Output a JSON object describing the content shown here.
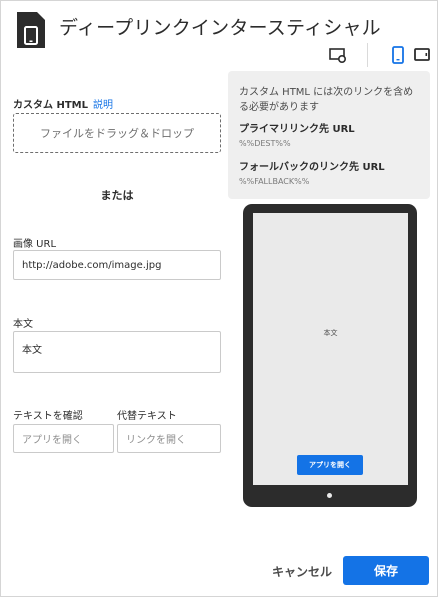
{
  "dialog": {
    "title": "ディープリンクインタースティシャル",
    "icons": [
      "mobile-page-icon",
      "preview-icon",
      "phone-icon",
      "tablet-icon"
    ],
    "accent_color": "#1473e6"
  },
  "form": {
    "custom_html_label": "カスタム HTML",
    "help_link": "説明",
    "dropzone_text": "ファイルをドラッグ＆ドロップ",
    "or_label": "または",
    "image_url": {
      "label": "画像 URL",
      "value": "http://adobe.com/image.jpg"
    },
    "body": {
      "label": "本文",
      "value": "本文"
    },
    "confirm_text": {
      "label": "テキストを確認",
      "placeholder": "アプリを開く"
    },
    "alt_text": {
      "label": "代替テキスト",
      "placeholder": "リンクを開く"
    }
  },
  "info": {
    "message": "カスタム HTML には次のリンクを含める必要があります",
    "primary_heading": "プライマリリンク先 URL",
    "primary_code": "%%DEST%%",
    "fallback_heading": "フォールバックのリンク先 URL",
    "fallback_code": "%%FALLBACK%%"
  },
  "preview": {
    "body_text": "本文",
    "button_label": "アプリを開く"
  },
  "footer": {
    "cancel_label": "キャンセル",
    "save_label": "保存"
  }
}
